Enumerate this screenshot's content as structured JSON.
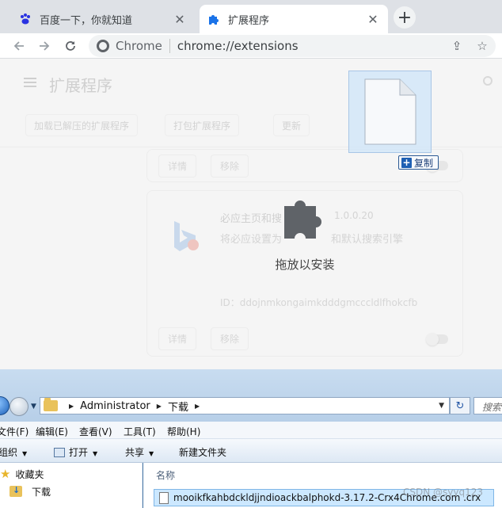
{
  "browser": {
    "tabs": [
      {
        "title": "百度一下，你就知道",
        "close": "✕",
        "active": false
      },
      {
        "title": "扩展程序",
        "close": "✕",
        "active": true
      }
    ],
    "new_tab": "+",
    "site_chip": "Chrome",
    "url": "chrome://extensions"
  },
  "extensions_page": {
    "title": "扩展程序",
    "actions": [
      "加载已解压的扩展程序",
      "打包扩展程序",
      "更新"
    ],
    "card1": {
      "details_btn": "详情",
      "remove_btn": "移除"
    },
    "card2": {
      "name": "必应主页和搜",
      "version": "1.0.0.20",
      "description": "将必应设置为",
      "description_tail": "和默认搜索引擎",
      "id": "ID：ddojnmkongaimkdddgmcccldlfhokcfb",
      "details_btn": "详情",
      "remove_btn": "移除"
    },
    "drop_label": "拖放以安装"
  },
  "drag": {
    "copy_label": "复制",
    "copy_plus": "+"
  },
  "explorer": {
    "breadcrumb": [
      "Administrator",
      "下载"
    ],
    "search_placeholder": "搜索",
    "menus": [
      "文件(F)",
      "编辑(E)",
      "查看(V)",
      "工具(T)",
      "帮助(H)"
    ],
    "commands": {
      "organize": "组织",
      "open": "打开",
      "share": "共享",
      "new_folder": "新建文件夹"
    },
    "nav": {
      "favorites": "收藏夹",
      "downloads": "下载"
    },
    "column_name": "名称",
    "file": "mooikfkahbdckldjjndioackbalphokd-3.17.2-Crx4Chrome.com .crx"
  },
  "watermark": "CSDN @syyq123",
  "colors": {
    "chrome_blue": "#1a73e8",
    "explorer_selection": "#cce8ff"
  }
}
